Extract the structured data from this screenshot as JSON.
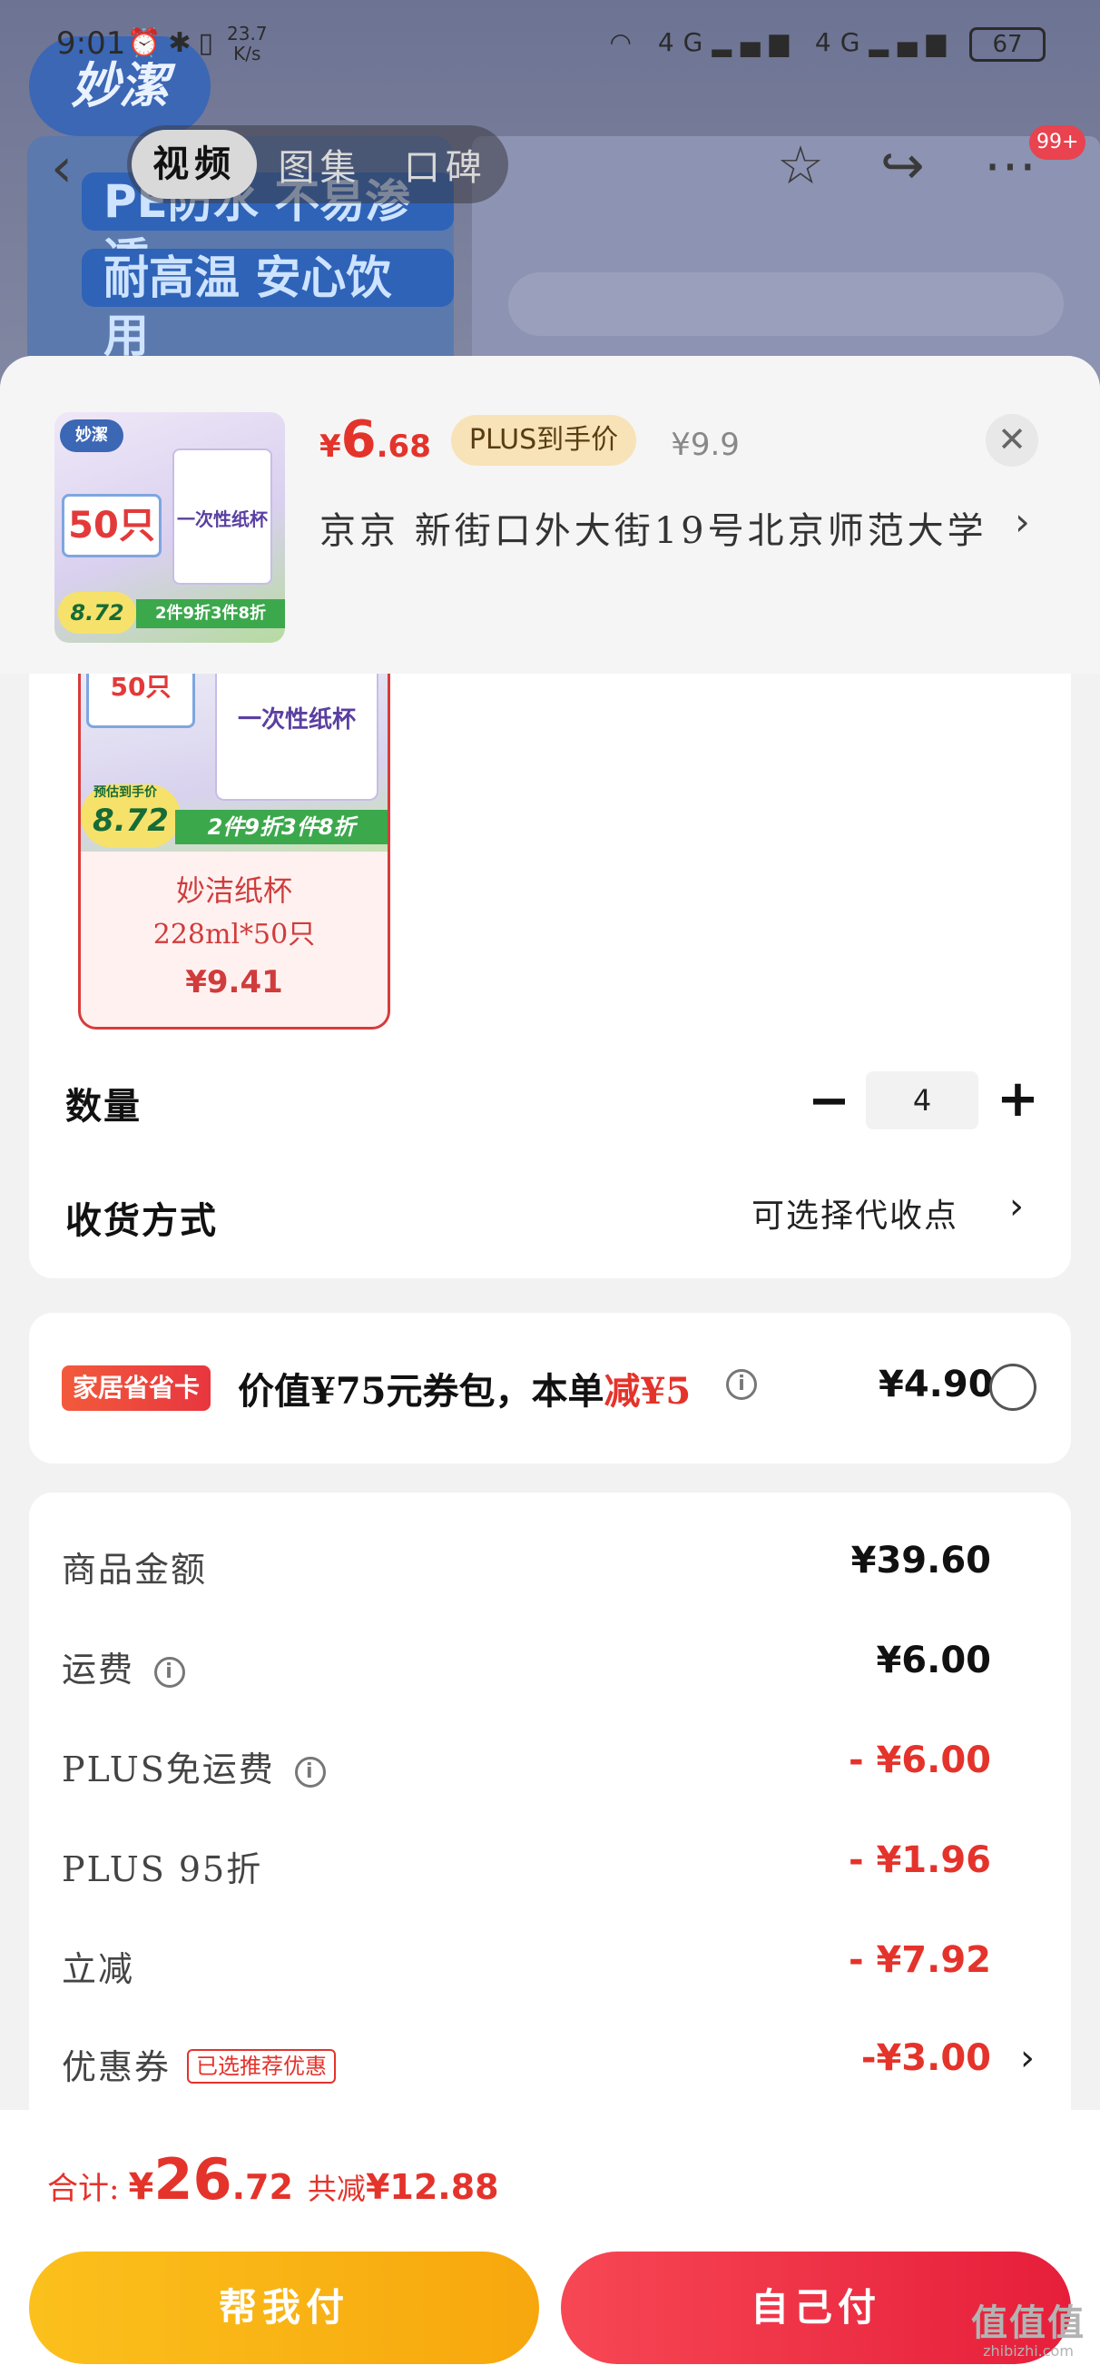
{
  "status_bar": {
    "time": "9:01",
    "speed_value": "23.7",
    "speed_unit": "K/s",
    "network": "4G",
    "battery": "67"
  },
  "background": {
    "brand_logo": "妙潔",
    "banner_1": "PE防水 不易渗透",
    "banner_2": "耐高温 安心饮用"
  },
  "top_nav": {
    "tabs": [
      "视频",
      "图集",
      "口碑"
    ],
    "active_tab": 0,
    "message_badge": "99+",
    "icons": [
      "back-icon",
      "star-icon",
      "share-icon",
      "more-icon"
    ]
  },
  "sheet": {
    "thumbnail": {
      "brand": "妙潔",
      "big_text": "50只",
      "cup_text": "一次性纸杯",
      "price_text": "8.72",
      "promo_text": "2件9折3件8折"
    },
    "price_yen": "¥",
    "price_int": "6",
    "price_dec": ".68",
    "plus_tag": "PLUS到手价",
    "original_price": "¥9.9",
    "address": "京京   新街口外大街19号北京师范大学",
    "icons": [
      "close-icon",
      "chevron-right-icon"
    ]
  },
  "variant": {
    "image_big": "50只",
    "image_cup": "一次性纸杯",
    "image_price_label": "预估到手价",
    "image_price": "8.72",
    "image_promo": "2件9折3件8折",
    "name": "妙洁纸杯",
    "spec": "228ml*50只",
    "price": "¥9.41"
  },
  "quantity": {
    "label": "数量",
    "value": "4",
    "minus": "−",
    "plus": "+"
  },
  "delivery": {
    "label": "收货方式",
    "value": "可选择代收点"
  },
  "saver_card": {
    "tag": "家居省省卡",
    "text_prefix": "价值¥75元券包，本单",
    "text_red": "减¥5",
    "price": "¥4.90",
    "selected": false
  },
  "fees": [
    {
      "label": "商品金额",
      "value": "¥39.60",
      "red": false,
      "info": false
    },
    {
      "label": "运费",
      "value": "¥6.00",
      "red": false,
      "info": true
    },
    {
      "label": "PLUS免运费",
      "value": "- ¥6.00",
      "red": true,
      "info": true
    },
    {
      "label": "PLUS 95折",
      "value": "- ¥1.96",
      "red": true,
      "info": false
    },
    {
      "label": "立减",
      "value": "- ¥7.92",
      "red": true,
      "info": false
    },
    {
      "label": "优惠券",
      "value": "-¥3.00",
      "red": true,
      "info": false,
      "tag": "已选推荐优惠"
    }
  ],
  "footer": {
    "total_label": "合计:",
    "total_yen": "¥",
    "total_int": "26",
    "total_dec": ".72",
    "saved_label": "共减",
    "saved_value": "¥12.88",
    "btn_help": "帮我付",
    "btn_self": "自己付"
  },
  "watermark": {
    "logo": "值值值",
    "url": "zhibizhi.com"
  },
  "colors": {
    "accent_red": "#e4332b",
    "plus_gold": "#f7e3b7",
    "btn_yellow": "#fbc01c",
    "btn_red": "#f74754"
  }
}
